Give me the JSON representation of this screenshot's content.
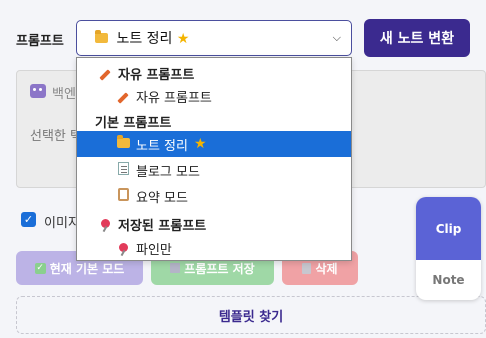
{
  "prompt": {
    "label": "프롬프트",
    "selected_value": "노트 정리",
    "selected_icon": "folder-icon"
  },
  "convert_button": "새 노트 변환",
  "text_panel": {
    "bot_label": "백엔",
    "placeholder": "선택한 텍"
  },
  "checkbox": {
    "label": "이미지",
    "checked": true
  },
  "actions": {
    "default_mode": "현재 기본 모드",
    "save_prompt": "프롬프트 저장",
    "delete": "삭제"
  },
  "template_button": "템플릿 찾기",
  "clip_widget": {
    "clip": "Clip",
    "note": "Note"
  },
  "dropdown": {
    "groups": [
      {
        "label": "자유 프롬프트",
        "icon": "pencil-icon"
      },
      {
        "label": "기본 프롬프트",
        "icon": ""
      },
      {
        "label": "저장된 프롬프트",
        "icon": "pushpin-icon"
      }
    ],
    "items": [
      {
        "label": "자유 프롬프트",
        "icon": "pencil-icon"
      },
      {
        "label": "노트 정리",
        "icon": "folder-icon",
        "selected": true
      },
      {
        "label": "블로그 모드",
        "icon": "memo-icon"
      },
      {
        "label": "요약 모드",
        "icon": "clipboard-icon"
      },
      {
        "label": "파인만",
        "icon": "pushpin-icon"
      }
    ]
  },
  "colors": {
    "primary": "#3b2a8f",
    "selected": "#1a6ed8",
    "clip": "#5b63d6"
  }
}
